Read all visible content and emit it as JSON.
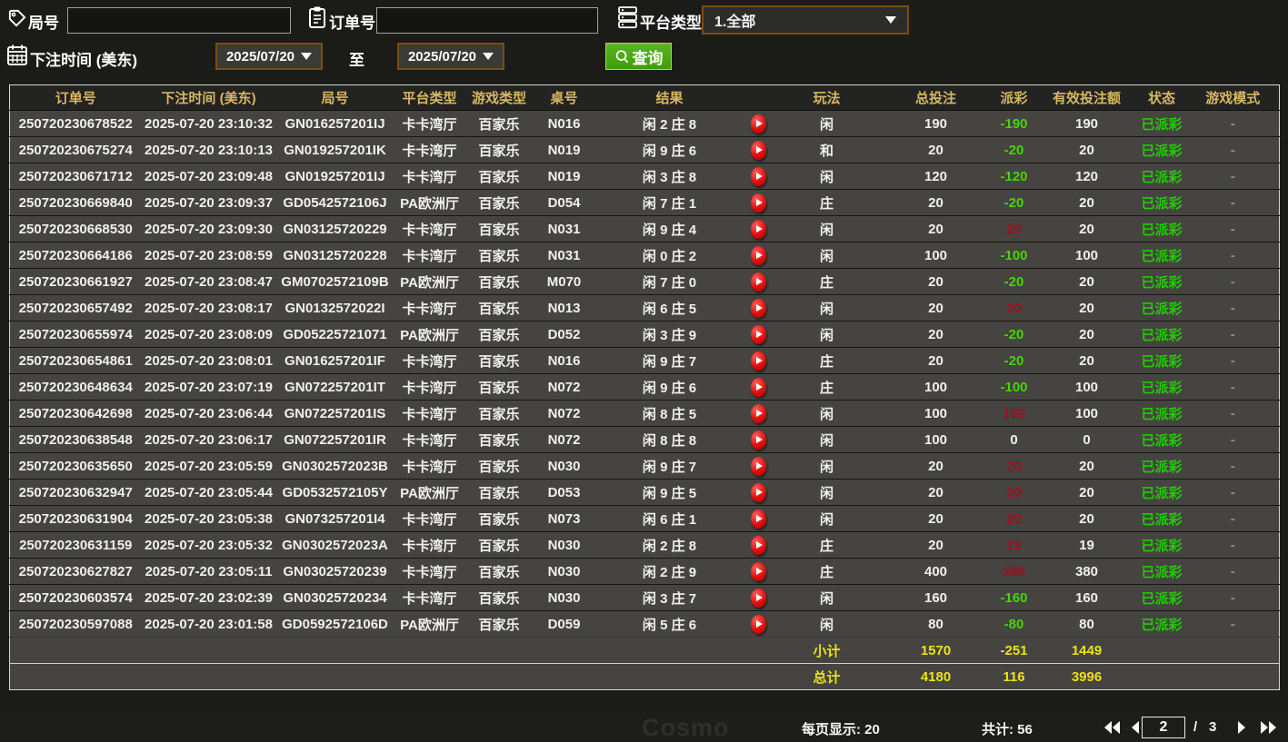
{
  "filters": {
    "round_label": "局号",
    "round_value": "",
    "order_label": "订单号",
    "order_value": "",
    "platform_label": "平台类型",
    "platform_value": "1.全部",
    "time_label": "下注时间 (美东)",
    "date_from": "2025/07/20",
    "to_label": "至",
    "date_to": "2025/07/20",
    "query_label": "查询"
  },
  "colors": {
    "accent_gold": "#d7b763",
    "sum_yellow": "#eae215",
    "status_green": "#20cc00",
    "payout_negative_green": "#43d600",
    "payout_positive_red": "#a30d20",
    "query_button_green": "#4aa713",
    "selector_border_brown": "#7a4d15"
  },
  "table": {
    "headers": [
      "订单号",
      "下注时间 (美东)",
      "局号",
      "平台类型",
      "游戏类型",
      "桌号",
      "结果",
      "",
      "玩法",
      "总投注",
      "派彩",
      "有效投注额",
      "状态",
      "游戏模式"
    ],
    "rows": [
      {
        "order": "250720230678522",
        "time": "2025-07-20 23:10:32",
        "round": "GN016257201IJ",
        "platform": "卡卡湾厅",
        "game": "百家乐",
        "table_no": "N016",
        "result": "闲 2 庄 8",
        "play_type": "闲",
        "bet_total": "190",
        "payout": "-190",
        "valid_bet": "190",
        "status": "已派彩",
        "mode": "-"
      },
      {
        "order": "250720230675274",
        "time": "2025-07-20 23:10:13",
        "round": "GN019257201IK",
        "platform": "卡卡湾厅",
        "game": "百家乐",
        "table_no": "N019",
        "result": "闲 9 庄 6",
        "play_type": "和",
        "bet_total": "20",
        "payout": "-20",
        "valid_bet": "20",
        "status": "已派彩",
        "mode": "-"
      },
      {
        "order": "250720230671712",
        "time": "2025-07-20 23:09:48",
        "round": "GN019257201IJ",
        "platform": "卡卡湾厅",
        "game": "百家乐",
        "table_no": "N019",
        "result": "闲 3 庄 8",
        "play_type": "闲",
        "bet_total": "120",
        "payout": "-120",
        "valid_bet": "120",
        "status": "已派彩",
        "mode": "-"
      },
      {
        "order": "250720230669840",
        "time": "2025-07-20 23:09:37",
        "round": "GD0542572106J",
        "platform": "PA欧洲厅",
        "game": "百家乐",
        "table_no": "D054",
        "result": "闲 7 庄 1",
        "play_type": "庄",
        "bet_total": "20",
        "payout": "-20",
        "valid_bet": "20",
        "status": "已派彩",
        "mode": "-"
      },
      {
        "order": "250720230668530",
        "time": "2025-07-20 23:09:30",
        "round": "GN03125720229",
        "platform": "卡卡湾厅",
        "game": "百家乐",
        "table_no": "N031",
        "result": "闲 9 庄 4",
        "play_type": "闲",
        "bet_total": "20",
        "payout": "20",
        "valid_bet": "20",
        "status": "已派彩",
        "mode": "-"
      },
      {
        "order": "250720230664186",
        "time": "2025-07-20 23:08:59",
        "round": "GN03125720228",
        "platform": "卡卡湾厅",
        "game": "百家乐",
        "table_no": "N031",
        "result": "闲 0 庄 2",
        "play_type": "闲",
        "bet_total": "100",
        "payout": "-100",
        "valid_bet": "100",
        "status": "已派彩",
        "mode": "-"
      },
      {
        "order": "250720230661927",
        "time": "2025-07-20 23:08:47",
        "round": "GM0702572109B",
        "platform": "PA欧洲厅",
        "game": "百家乐",
        "table_no": "M070",
        "result": "闲 7 庄 0",
        "play_type": "庄",
        "bet_total": "20",
        "payout": "-20",
        "valid_bet": "20",
        "status": "已派彩",
        "mode": "-"
      },
      {
        "order": "250720230657492",
        "time": "2025-07-20 23:08:17",
        "round": "GN0132572022I",
        "platform": "卡卡湾厅",
        "game": "百家乐",
        "table_no": "N013",
        "result": "闲 6 庄 5",
        "play_type": "闲",
        "bet_total": "20",
        "payout": "20",
        "valid_bet": "20",
        "status": "已派彩",
        "mode": "-"
      },
      {
        "order": "250720230655974",
        "time": "2025-07-20 23:08:09",
        "round": "GD05225721071",
        "platform": "PA欧洲厅",
        "game": "百家乐",
        "table_no": "D052",
        "result": "闲 3 庄 9",
        "play_type": "闲",
        "bet_total": "20",
        "payout": "-20",
        "valid_bet": "20",
        "status": "已派彩",
        "mode": "-"
      },
      {
        "order": "250720230654861",
        "time": "2025-07-20 23:08:01",
        "round": "GN016257201IF",
        "platform": "卡卡湾厅",
        "game": "百家乐",
        "table_no": "N016",
        "result": "闲 9 庄 7",
        "play_type": "庄",
        "bet_total": "20",
        "payout": "-20",
        "valid_bet": "20",
        "status": "已派彩",
        "mode": "-"
      },
      {
        "order": "250720230648634",
        "time": "2025-07-20 23:07:19",
        "round": "GN072257201IT",
        "platform": "卡卡湾厅",
        "game": "百家乐",
        "table_no": "N072",
        "result": "闲 9 庄 6",
        "play_type": "庄",
        "bet_total": "100",
        "payout": "-100",
        "valid_bet": "100",
        "status": "已派彩",
        "mode": "-"
      },
      {
        "order": "250720230642698",
        "time": "2025-07-20 23:06:44",
        "round": "GN072257201IS",
        "platform": "卡卡湾厅",
        "game": "百家乐",
        "table_no": "N072",
        "result": "闲 8 庄 5",
        "play_type": "闲",
        "bet_total": "100",
        "payout": "100",
        "valid_bet": "100",
        "status": "已派彩",
        "mode": "-"
      },
      {
        "order": "250720230638548",
        "time": "2025-07-20 23:06:17",
        "round": "GN072257201IR",
        "platform": "卡卡湾厅",
        "game": "百家乐",
        "table_no": "N072",
        "result": "闲 8 庄 8",
        "play_type": "闲",
        "bet_total": "100",
        "payout": "0",
        "valid_bet": "0",
        "status": "已派彩",
        "mode": "-"
      },
      {
        "order": "250720230635650",
        "time": "2025-07-20 23:05:59",
        "round": "GN0302572023B",
        "platform": "卡卡湾厅",
        "game": "百家乐",
        "table_no": "N030",
        "result": "闲 9 庄 7",
        "play_type": "闲",
        "bet_total": "20",
        "payout": "20",
        "valid_bet": "20",
        "status": "已派彩",
        "mode": "-"
      },
      {
        "order": "250720230632947",
        "time": "2025-07-20 23:05:44",
        "round": "GD0532572105Y",
        "platform": "PA欧洲厅",
        "game": "百家乐",
        "table_no": "D053",
        "result": "闲 9 庄 5",
        "play_type": "闲",
        "bet_total": "20",
        "payout": "20",
        "valid_bet": "20",
        "status": "已派彩",
        "mode": "-"
      },
      {
        "order": "250720230631904",
        "time": "2025-07-20 23:05:38",
        "round": "GN073257201I4",
        "platform": "卡卡湾厅",
        "game": "百家乐",
        "table_no": "N073",
        "result": "闲 6 庄 1",
        "play_type": "闲",
        "bet_total": "20",
        "payout": "20",
        "valid_bet": "20",
        "status": "已派彩",
        "mode": "-"
      },
      {
        "order": "250720230631159",
        "time": "2025-07-20 23:05:32",
        "round": "GN0302572023A",
        "platform": "卡卡湾厅",
        "game": "百家乐",
        "table_no": "N030",
        "result": "闲 2 庄 8",
        "play_type": "庄",
        "bet_total": "20",
        "payout": "19",
        "valid_bet": "19",
        "status": "已派彩",
        "mode": "-"
      },
      {
        "order": "250720230627827",
        "time": "2025-07-20 23:05:11",
        "round": "GN03025720239",
        "platform": "卡卡湾厅",
        "game": "百家乐",
        "table_no": "N030",
        "result": "闲 2 庄 9",
        "play_type": "庄",
        "bet_total": "400",
        "payout": "380",
        "valid_bet": "380",
        "status": "已派彩",
        "mode": "-"
      },
      {
        "order": "250720230603574",
        "time": "2025-07-20 23:02:39",
        "round": "GN03025720234",
        "platform": "卡卡湾厅",
        "game": "百家乐",
        "table_no": "N030",
        "result": "闲 3 庄 7",
        "play_type": "闲",
        "bet_total": "160",
        "payout": "-160",
        "valid_bet": "160",
        "status": "已派彩",
        "mode": "-"
      },
      {
        "order": "250720230597088",
        "time": "2025-07-20 23:01:58",
        "round": "GD0592572106D",
        "platform": "PA欧洲厅",
        "game": "百家乐",
        "table_no": "D059",
        "result": "闲 5 庄 6",
        "play_type": "闲",
        "bet_total": "80",
        "payout": "-80",
        "valid_bet": "80",
        "status": "已派彩",
        "mode": "-"
      }
    ],
    "subtotal": {
      "label": "小计",
      "bet_total": "1570",
      "payout": "-251",
      "valid_bet": "1449"
    },
    "total": {
      "label": "总计",
      "bet_total": "4180",
      "payout": "116",
      "valid_bet": "3996"
    }
  },
  "footer": {
    "page_size_label": "每页显示: 20",
    "total_count_label": "共计: 56",
    "current_page": "2",
    "page_separator": "/",
    "total_pages": "3"
  },
  "watermark": "Cosmo"
}
